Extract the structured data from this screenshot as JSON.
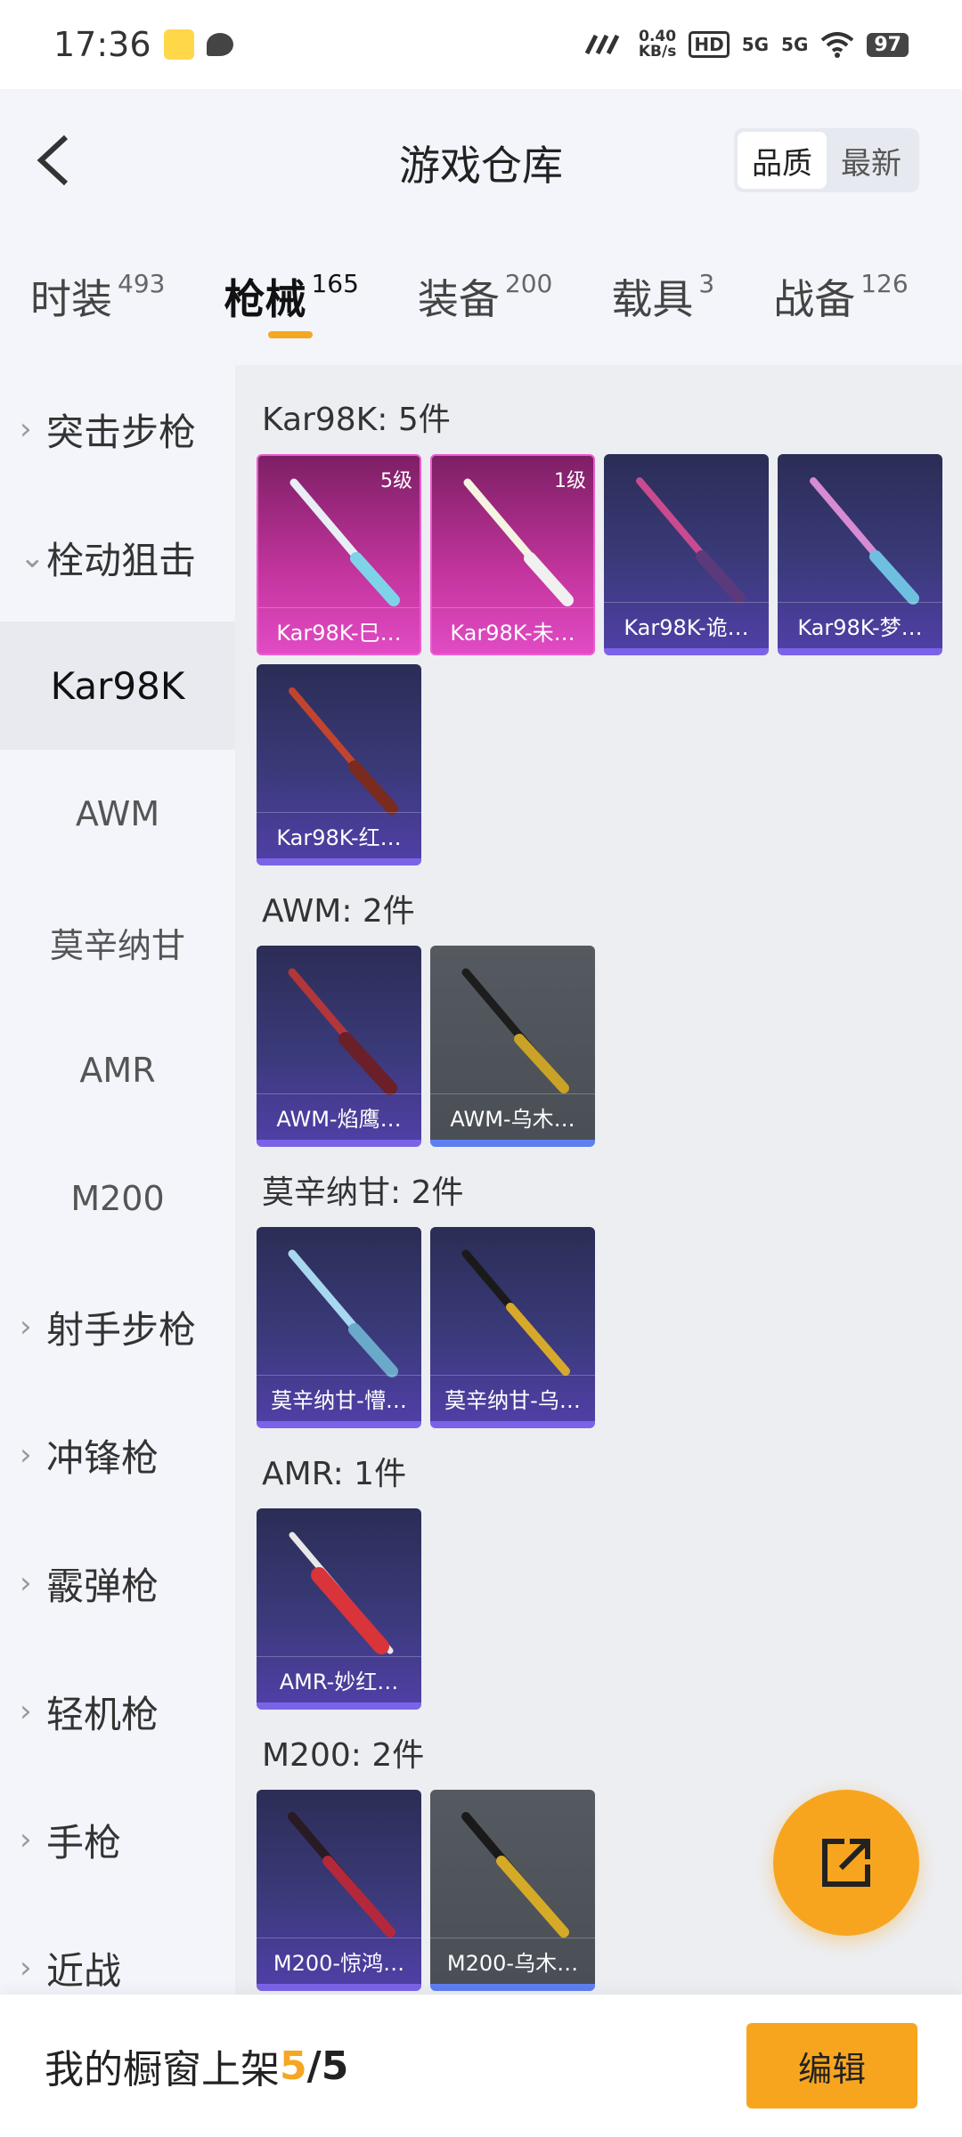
{
  "status_bar": {
    "time": "17:36",
    "net_speed_value": "0.40",
    "net_speed_unit": "KB/s",
    "hd_label": "HD",
    "signal1": "5G",
    "signal2": "5G",
    "battery": "97"
  },
  "header": {
    "title": "游戏仓库",
    "sort_options": [
      "品质",
      "最新"
    ],
    "sort_selected": "品质"
  },
  "tabs": [
    {
      "label": "时装",
      "count": "493"
    },
    {
      "label": "枪械",
      "count": "165",
      "active": true
    },
    {
      "label": "装备",
      "count": "200"
    },
    {
      "label": "载具",
      "count": "3"
    },
    {
      "label": "战备",
      "count": "126"
    }
  ],
  "sidebar": {
    "items": [
      {
        "label": "突击步枪"
      },
      {
        "label": "栓动狙击"
      },
      {
        "label": "Kar98K"
      },
      {
        "label": "AWM"
      },
      {
        "label": "莫辛纳甘"
      },
      {
        "label": "AMR"
      },
      {
        "label": "M200"
      },
      {
        "label": "射手步枪"
      },
      {
        "label": "冲锋枪"
      },
      {
        "label": "霰弹枪"
      },
      {
        "label": "轻机枪"
      },
      {
        "label": "手枪"
      },
      {
        "label": "近战"
      }
    ]
  },
  "groups": [
    {
      "title": "Kar98K: 5件",
      "items": [
        {
          "name": "Kar98K-巳…",
          "level": "5级",
          "rarity": "pink"
        },
        {
          "name": "Kar98K-未…",
          "level": "1级",
          "rarity": "pink"
        },
        {
          "name": "Kar98K-诡…",
          "rarity": "purple"
        },
        {
          "name": "Kar98K-梦…",
          "rarity": "purple"
        },
        {
          "name": "Kar98K-红…",
          "rarity": "purple"
        }
      ]
    },
    {
      "title": "AWM: 2件",
      "items": [
        {
          "name": "AWM-焰鹰…",
          "rarity": "purple"
        },
        {
          "name": "AWM-乌木…",
          "rarity": "gray"
        }
      ]
    },
    {
      "title": "莫辛纳甘: 2件",
      "items": [
        {
          "name": "莫辛纳甘-懵…",
          "rarity": "purple"
        },
        {
          "name": "莫辛纳甘-乌…",
          "rarity": "purple"
        }
      ]
    },
    {
      "title": "AMR: 1件",
      "items": [
        {
          "name": "AMR-妙红…",
          "rarity": "purple"
        }
      ]
    },
    {
      "title": "M200: 2件",
      "items": [
        {
          "name": "M200-惊鸿…",
          "rarity": "purple"
        },
        {
          "name": "M200-乌木…",
          "rarity": "gray"
        }
      ]
    }
  ],
  "bottom": {
    "label": "我的橱窗上架",
    "current": "5",
    "separator": "/",
    "max": "5",
    "edit_label": "编辑"
  },
  "colors": {
    "accent": "#f7a51f",
    "rarity_pink": "#e14bc4",
    "rarity_purple": "#4f3fa5",
    "rarity_gray": "#4a4e55"
  }
}
